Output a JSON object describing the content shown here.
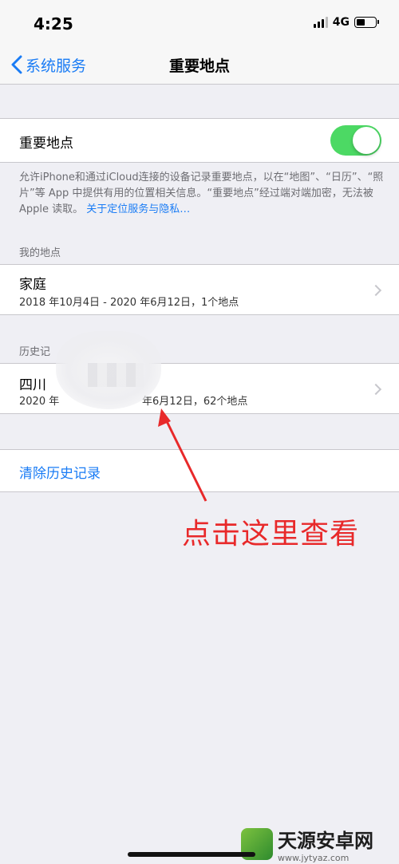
{
  "status_bar": {
    "time": "4:25",
    "network": "4G",
    "battery_level": 0.45
  },
  "nav": {
    "back_label": "系统服务",
    "title": "重要地点"
  },
  "toggle_row": {
    "label": "重要地点",
    "enabled": true
  },
  "footnote": {
    "text": "允许iPhone和通过iCloud连接的设备记录重要地点，以在“地图”、“日历”、“照片”等 App 中提供有用的位置相关信息。“重要地点”经过端对端加密，无法被 Apple 读取。",
    "link": "关于定位服务与隐私…"
  },
  "my_places": {
    "header": "我的地点",
    "items": [
      {
        "title": "家庭",
        "subtitle": "2018 年10月4日 - 2020 年6月12日，1个地点"
      }
    ]
  },
  "history": {
    "header": "历史记",
    "items": [
      {
        "title": "四川",
        "subtitle": "2020 年",
        "subtitle_tail": "年6月12日，62个地点"
      }
    ]
  },
  "clear_history": {
    "label": "清除历史记录"
  },
  "annotation": {
    "text": "点击这里查看"
  },
  "watermark": {
    "name": "天源安卓网",
    "url": "www.jytyaz.com"
  },
  "colors": {
    "accent": "#1a7cf5",
    "toggle_on": "#4cd964",
    "annotation": "#e8292a",
    "background": "#efeff4"
  }
}
